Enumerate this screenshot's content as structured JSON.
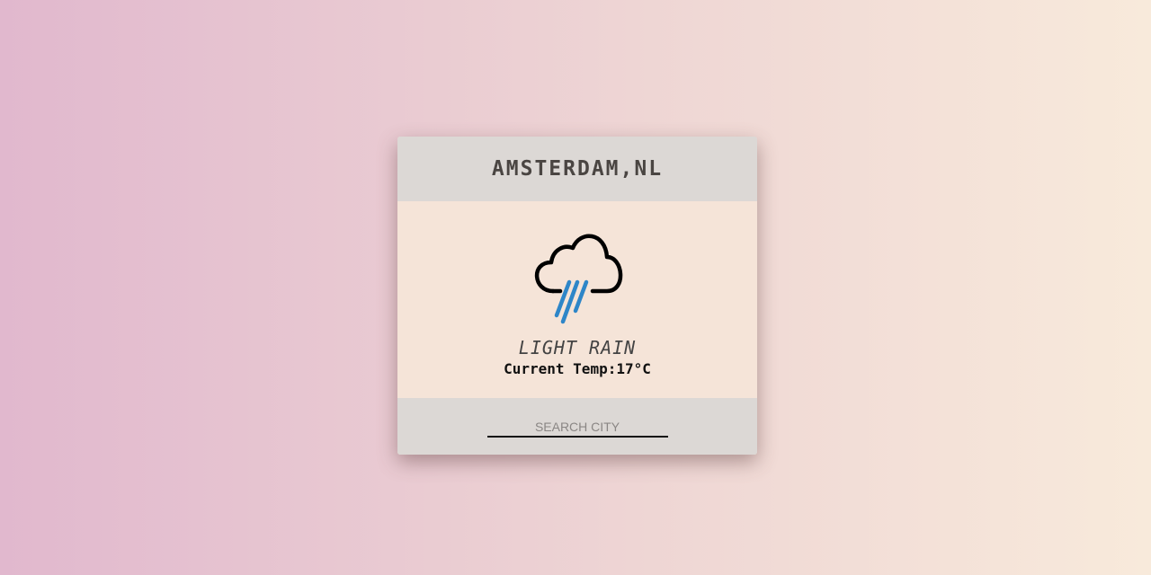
{
  "header": {
    "city": "AMSTERDAM,NL"
  },
  "weather": {
    "icon": "rain-cloud-icon",
    "condition": "LIGHT RAIN",
    "temp_label": "Current Temp:",
    "temp_value": "17°C"
  },
  "search": {
    "placeholder": "SEARCH CITY",
    "value": ""
  },
  "colors": {
    "rain_drops": "#2e86c8",
    "cloud_outline": "#000000",
    "header_footer_bg": "#dcd8d5",
    "body_bg": "#f5e4d8"
  }
}
